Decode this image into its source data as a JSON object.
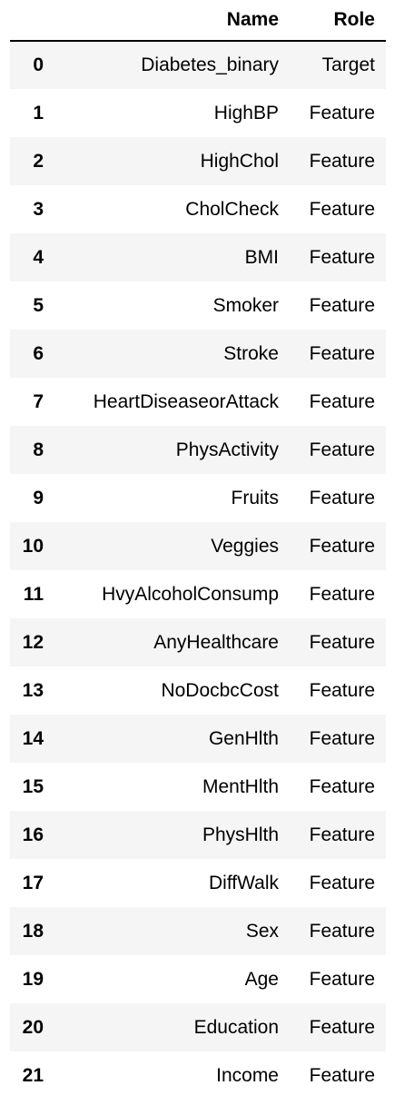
{
  "table": {
    "columns": [
      "Name",
      "Role"
    ],
    "rows": [
      {
        "index": "0",
        "name": "Diabetes_binary",
        "role": "Target"
      },
      {
        "index": "1",
        "name": "HighBP",
        "role": "Feature"
      },
      {
        "index": "2",
        "name": "HighChol",
        "role": "Feature"
      },
      {
        "index": "3",
        "name": "CholCheck",
        "role": "Feature"
      },
      {
        "index": "4",
        "name": "BMI",
        "role": "Feature"
      },
      {
        "index": "5",
        "name": "Smoker",
        "role": "Feature"
      },
      {
        "index": "6",
        "name": "Stroke",
        "role": "Feature"
      },
      {
        "index": "7",
        "name": "HeartDiseaseorAttack",
        "role": "Feature"
      },
      {
        "index": "8",
        "name": "PhysActivity",
        "role": "Feature"
      },
      {
        "index": "9",
        "name": "Fruits",
        "role": "Feature"
      },
      {
        "index": "10",
        "name": "Veggies",
        "role": "Feature"
      },
      {
        "index": "11",
        "name": "HvyAlcoholConsump",
        "role": "Feature"
      },
      {
        "index": "12",
        "name": "AnyHealthcare",
        "role": "Feature"
      },
      {
        "index": "13",
        "name": "NoDocbcCost",
        "role": "Feature"
      },
      {
        "index": "14",
        "name": "GenHlth",
        "role": "Feature"
      },
      {
        "index": "15",
        "name": "MentHlth",
        "role": "Feature"
      },
      {
        "index": "16",
        "name": "PhysHlth",
        "role": "Feature"
      },
      {
        "index": "17",
        "name": "DiffWalk",
        "role": "Feature"
      },
      {
        "index": "18",
        "name": "Sex",
        "role": "Feature"
      },
      {
        "index": "19",
        "name": "Age",
        "role": "Feature"
      },
      {
        "index": "20",
        "name": "Education",
        "role": "Feature"
      },
      {
        "index": "21",
        "name": "Income",
        "role": "Feature"
      }
    ]
  },
  "colors": {
    "stripe": "#f5f5f5",
    "background": "#ffffff",
    "text": "#000000",
    "header_rule": "#000000"
  }
}
